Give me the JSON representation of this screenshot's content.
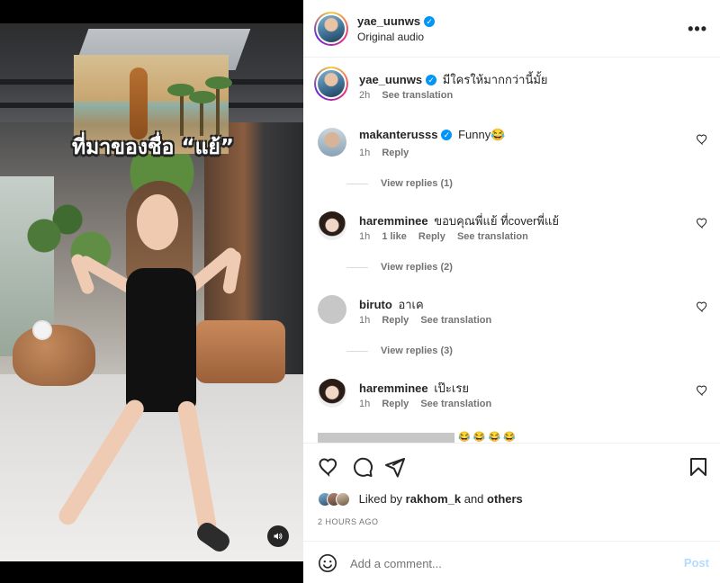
{
  "post": {
    "author": "yae_uunws",
    "audio": "Original audio",
    "caption_user": "yae_uunws",
    "caption_text": "มีใครให้มากกว่านี้มั้ย",
    "caption_time": "2h",
    "see_translation": "See translation"
  },
  "video": {
    "overlay_text": "ที่มาของชื่อ “แย้”"
  },
  "comments": [
    {
      "user": "makanterusss",
      "verified": true,
      "text": "Funny😂",
      "time": "1h",
      "likes": "",
      "reply": "Reply",
      "translate": "",
      "view_replies": "View replies (1)"
    },
    {
      "user": "haremminee",
      "verified": false,
      "text": "ขอบคุณพี่แย้ ที่coverพี่แย้",
      "time": "1h",
      "likes": "1 like",
      "reply": "Reply",
      "translate": "See translation",
      "view_replies": "View replies (2)"
    },
    {
      "user": "biruto",
      "verified": false,
      "text": "อาเค",
      "time": "1h",
      "likes": "",
      "reply": "Reply",
      "translate": "See translation",
      "view_replies": "View replies (3)"
    },
    {
      "user": "haremminee",
      "verified": false,
      "text": "เป๊ะเรย",
      "time": "1h",
      "likes": "",
      "reply": "Reply",
      "translate": "See translation",
      "view_replies": ""
    }
  ],
  "partial_comment": "😂 😂 😂 😂",
  "likes": {
    "prefix": "Liked by",
    "user": "rakhom_k",
    "middle": "and",
    "others": "others"
  },
  "time_ago": "2 HOURS AGO",
  "composer": {
    "placeholder": "Add a comment...",
    "post_label": "Post"
  },
  "colors": {
    "verified": "#0095f6",
    "post_disabled": "#b3dbff",
    "secondary_text": "#737373"
  },
  "icons": [
    "more-icon",
    "verified-icon",
    "heart-icon",
    "comment-icon",
    "share-icon",
    "bookmark-icon",
    "emoji-icon",
    "sound-icon"
  ]
}
